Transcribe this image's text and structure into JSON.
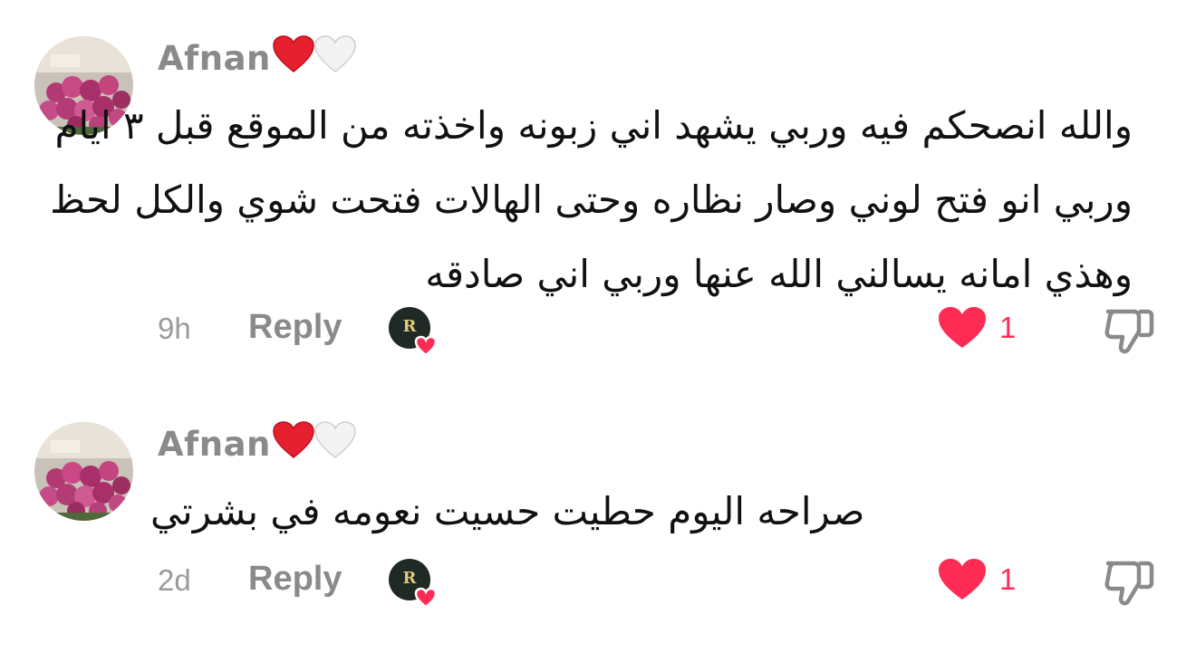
{
  "comments": [
    {
      "username": "Afnan",
      "emoji": [
        "red-heart",
        "white-heart"
      ],
      "lines": [
        "والله انصحكم فيه وربي يشهد اني زبونه واخذته من الموقع قبل ٣ ايام",
        "وربي انو فتح لوني وصار نظاره وحتى الهالات فتحت شوي والكل لحظ",
        "وهذي امانه يسالني الله عنها وربي اني صادقه"
      ],
      "time": "9h",
      "reply_label": "Reply",
      "likes": "1"
    },
    {
      "username": "Afnan",
      "emoji": [
        "red-heart",
        "white-heart"
      ],
      "lines": [
        "صراحه اليوم حطيت حسيت نعومه في بشرتي"
      ],
      "time": "2d",
      "reply_label": "Reply",
      "likes": "1"
    }
  ],
  "colors": {
    "like_red": "#fe2c55",
    "muted_text": "#8a8a8a",
    "body_text": "#111111"
  }
}
